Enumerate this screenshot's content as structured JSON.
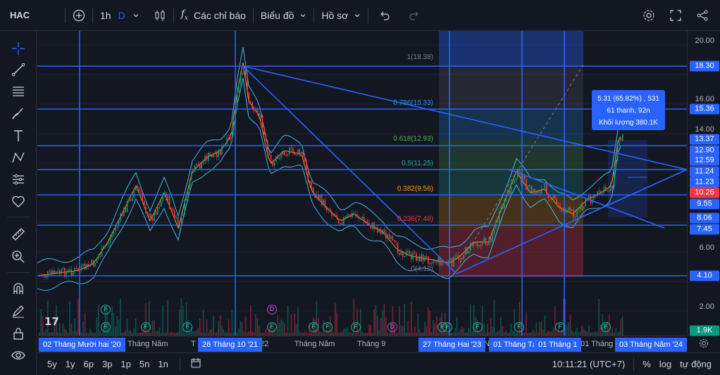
{
  "header": {
    "symbol": "HAC",
    "interval": "1h",
    "interval_type": "D",
    "indicators_label": "Các chỉ báo",
    "chart_type_label": "Biểu đồ",
    "profile_label": "Hồ sơ"
  },
  "tooltip": {
    "line1": "5.31 (65.82%) , 531",
    "line2": "61 thanh, 92n",
    "line3": "Khối lượng 380.1K"
  },
  "fib_levels": [
    {
      "label": "1(18.38)",
      "color": "#787b86"
    },
    {
      "label": "0.786(15.33)",
      "color": "#2196f3"
    },
    {
      "label": "0.618(12.93)",
      "color": "#4caf50"
    },
    {
      "label": "0.5(11.25)",
      "color": "#22ab94"
    },
    {
      "label": "0.382(9.56)",
      "color": "#ff9800"
    },
    {
      "label": "0.236(7.48)",
      "color": "#f23645"
    },
    {
      "label": "0(4.12)",
      "color": "#787b86"
    }
  ],
  "price_scale": {
    "ticks": [
      "20.00",
      "16.00",
      "14.00",
      "6.00",
      "2.00"
    ],
    "tags": [
      {
        "value": "18.30",
        "color": "#2962ff"
      },
      {
        "value": "15.36",
        "color": "#2962ff"
      },
      {
        "value": "13.37",
        "color": "#2962ff"
      },
      {
        "value": "12.90",
        "color": "#2962ff"
      },
      {
        "value": "12.59",
        "color": "#2962ff"
      },
      {
        "value": "11.24",
        "color": "#2962ff"
      },
      {
        "value": "11.23",
        "color": "#2962ff"
      },
      {
        "value": "10.26",
        "color": "#f23645"
      },
      {
        "value": "9.55",
        "color": "#2962ff"
      },
      {
        "value": "8.06",
        "color": "#2962ff"
      },
      {
        "value": "7.45",
        "color": "#2962ff"
      },
      {
        "value": "4.10",
        "color": "#2962ff"
      },
      {
        "value": "1.9K",
        "color": "#089981"
      }
    ]
  },
  "time_axis": {
    "labels": [
      "Tháng Năm",
      "T",
      "22",
      "Tháng Năm",
      "Tháng 9",
      "N",
      "01 Tháng"
    ],
    "tags": [
      "02 Tháng Mười hai '20",
      "26 Tháng 10 '21",
      "27 Tháng Hai '23",
      "01 Tháng Tá",
      "01 Tháng 1",
      "03 Tháng Năm '24"
    ]
  },
  "bottom": {
    "ranges": [
      "5y",
      "1y",
      "6p",
      "3p",
      "1p",
      "5n",
      "1n"
    ],
    "clock": "10:11:21 (UTC+7)",
    "percent": "%",
    "log": "log",
    "auto": "tự động"
  },
  "events": [
    "F",
    "F",
    "D",
    "F"
  ],
  "accent": "#2962ff"
}
